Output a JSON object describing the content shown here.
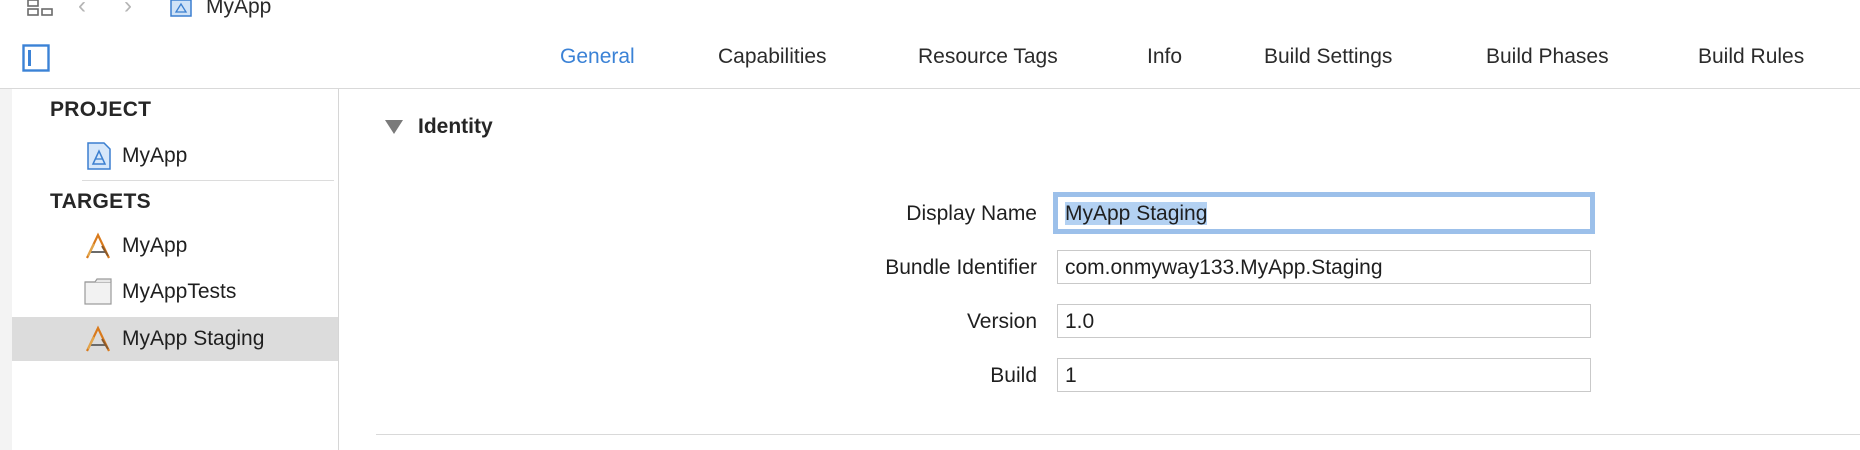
{
  "topbar": {
    "breadcrumb": "MyApp",
    "back_icon": "‹",
    "forward_icon": "›"
  },
  "tabs": [
    {
      "label": "General",
      "active": true
    },
    {
      "label": "Capabilities",
      "active": false
    },
    {
      "label": "Resource Tags",
      "active": false
    },
    {
      "label": "Info",
      "active": false
    },
    {
      "label": "Build Settings",
      "active": false
    },
    {
      "label": "Build Phases",
      "active": false
    },
    {
      "label": "Build Rules",
      "active": false
    }
  ],
  "sidebar": {
    "project_header": "PROJECT",
    "project_item": "MyApp",
    "targets_header": "TARGETS",
    "targets": [
      {
        "label": "MyApp",
        "icon": "app-target-icon",
        "selected": false
      },
      {
        "label": "MyAppTests",
        "icon": "test-bundle-icon",
        "selected": false
      },
      {
        "label": "MyApp Staging",
        "icon": "app-target-icon",
        "selected": true
      }
    ]
  },
  "identity": {
    "title": "Identity",
    "display_name_label": "Display Name",
    "display_name_value": "MyApp Staging",
    "bundle_id_label": "Bundle Identifier",
    "bundle_id_value": "com.onmyway133.MyApp.Staging",
    "version_label": "Version",
    "version_value": "1.0",
    "build_label": "Build",
    "build_value": "1"
  },
  "colors": {
    "accent": "#3b82d6",
    "selection": "#dcdcdc",
    "focus_ring": "#9cc0ea",
    "text_selection": "#b3d1f2"
  }
}
